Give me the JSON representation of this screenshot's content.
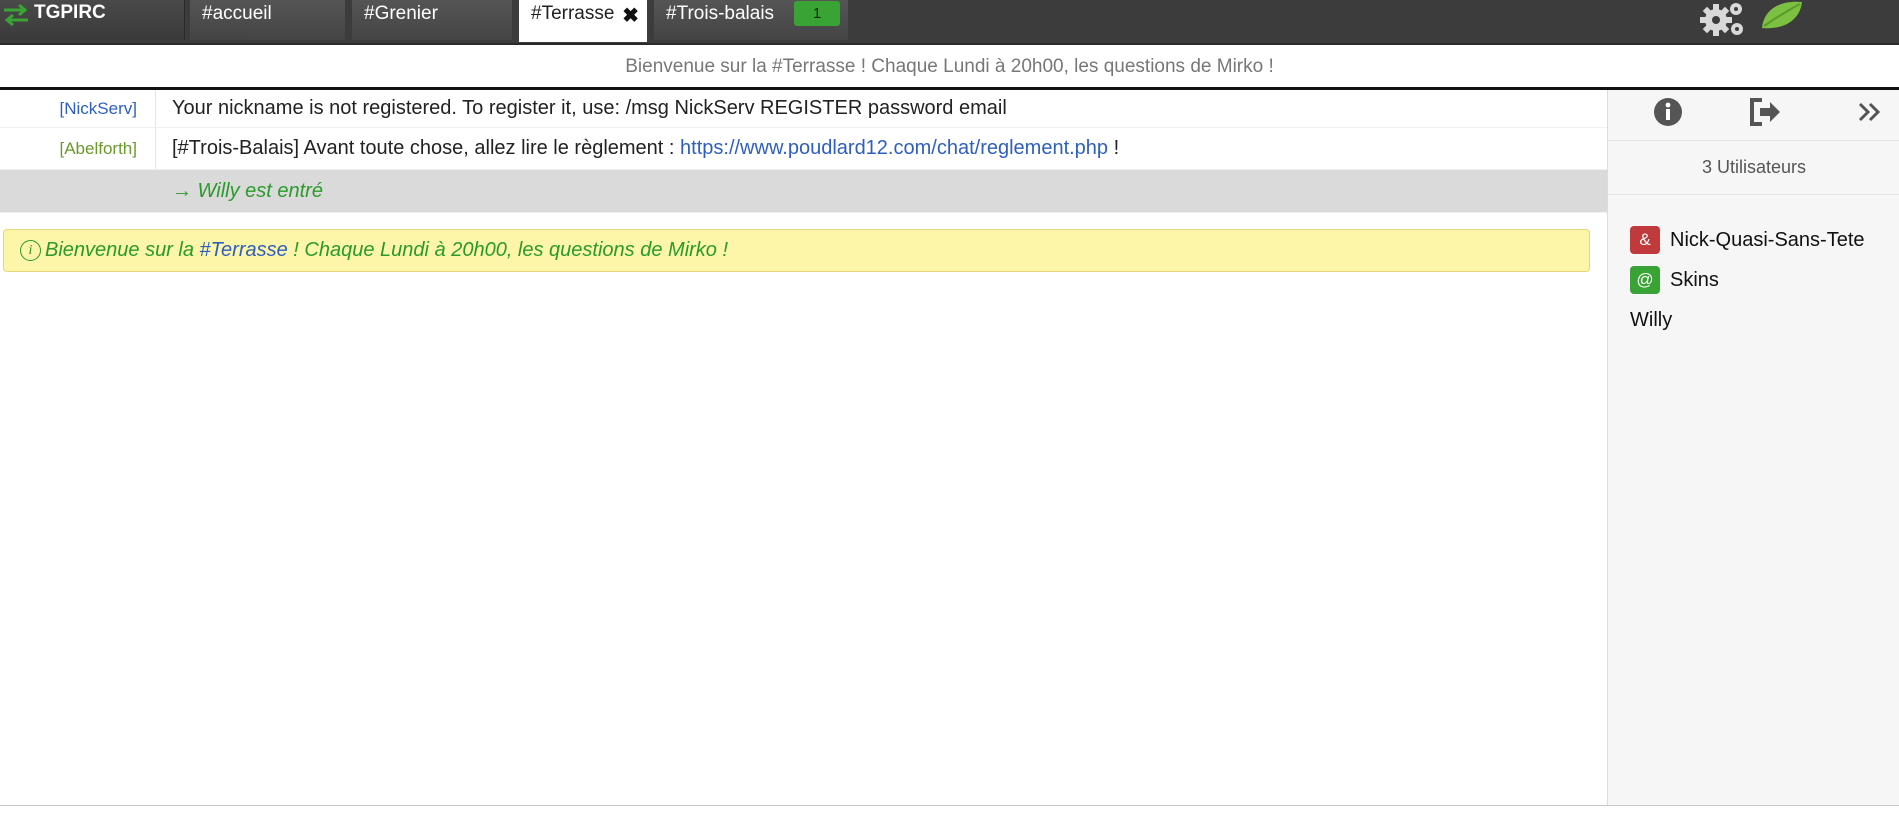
{
  "app": {
    "name": "TGPIRC"
  },
  "tabs": [
    {
      "label": "#accueil"
    },
    {
      "label": "#Grenier"
    },
    {
      "label": "#Terrasse",
      "active": true
    },
    {
      "label": "#Trois-balais",
      "badge": "1"
    }
  ],
  "topic": "Bienvenue sur la #Terrasse ! Chaque Lundi à 20h00, les questions de Mirko !",
  "messages": [
    {
      "nick": "[NickServ]",
      "text": "Your nickname is not registered. To register it, use: /msg NickServ REGISTER password email",
      "nick_color": "#2e5fbf"
    },
    {
      "nick": "[Abelforth]",
      "text_before": "[#Trois-Balais] Avant toute chose, allez lire le règlement : ",
      "link": "https://www.poudlard12.com/chat/reglement.php",
      "text_after": " !",
      "nick_color": "#6a9a2a"
    },
    {
      "join_text": "→ Willy est entré"
    }
  ],
  "notice": {
    "before": "Bienvenue sur la ",
    "channel": "#Terrasse",
    "after": " ! Chaque Lundi à 20h00, les questions de Mirko !"
  },
  "sidebar": {
    "user_count": "3 Utilisateurs",
    "users": [
      {
        "prefix": "&",
        "name": "Nick-Quasi-Sans-Tete",
        "prefix_color": "#c0393b"
      },
      {
        "prefix": "@",
        "name": "Skins",
        "prefix_color": "#3aa335"
      },
      {
        "prefix": "",
        "name": "Willy"
      }
    ]
  },
  "icons": {
    "brand": "swap-arrows-icon",
    "settings": "gears-icon",
    "logo": "leaf-icon",
    "channel_info": "info-circle-icon",
    "leave": "sign-out-icon",
    "collapse": "double-chevron-right-icon"
  }
}
